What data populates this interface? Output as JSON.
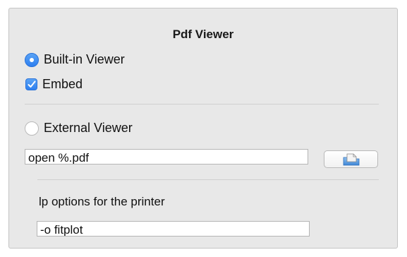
{
  "dialog": {
    "title": "Pdf Viewer",
    "builtin_viewer": {
      "label": "Built-in Viewer",
      "selected": true
    },
    "embed": {
      "label": "Embed",
      "checked": true
    },
    "external_viewer": {
      "label": "External Viewer",
      "selected": false
    },
    "viewer_command": {
      "value": "open %.pdf"
    },
    "browse_icon": "document-folder-icon",
    "lp_options": {
      "label": "lp options for the printer",
      "value": "-o fitplot"
    }
  },
  "colors": {
    "accent": "#2d7ff0",
    "panel_background": "#e8e8e8"
  }
}
